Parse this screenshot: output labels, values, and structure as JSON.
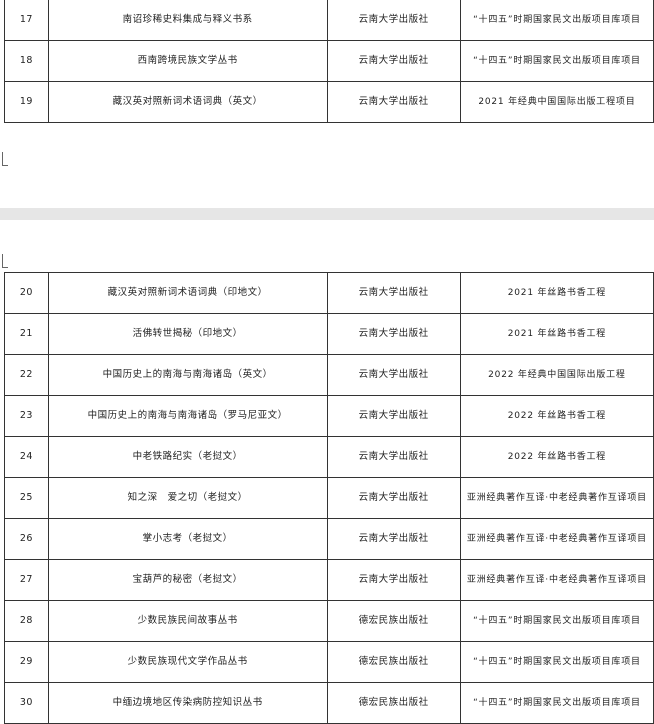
{
  "table_top": {
    "rows": [
      {
        "no": "17",
        "title": "南诏珍稀史料集成与释义书系",
        "publisher": "云南大学出版社",
        "project": "“十四五”时期国家民文出版项目库项目"
      },
      {
        "no": "18",
        "title": "西南跨境民族文学丛书",
        "publisher": "云南大学出版社",
        "project": "“十四五”时期国家民文出版项目库项目"
      },
      {
        "no": "19",
        "title": "藏汉英对照新词术语词典（英文）",
        "publisher": "云南大学出版社",
        "project": "2021 年经典中国国际出版工程项目"
      }
    ]
  },
  "table_bottom": {
    "rows": [
      {
        "no": "20",
        "title": "藏汉英对照新词术语词典（印地文）",
        "publisher": "云南大学出版社",
        "project": "2021 年丝路书香工程"
      },
      {
        "no": "21",
        "title": "活佛转世揭秘（印地文）",
        "publisher": "云南大学出版社",
        "project": "2021 年丝路书香工程"
      },
      {
        "no": "22",
        "title": "中国历史上的南海与南海诸岛（英文）",
        "publisher": "云南大学出版社",
        "project": "2022 年经典中国国际出版工程"
      },
      {
        "no": "23",
        "title": "中国历史上的南海与南海诸岛（罗马尼亚文）",
        "publisher": "云南大学出版社",
        "project": "2022 年丝路书香工程"
      },
      {
        "no": "24",
        "title": "中老铁路纪实（老挝文）",
        "publisher": "云南大学出版社",
        "project": "2022 年丝路书香工程"
      },
      {
        "no": "25",
        "title": "知之深　爱之切（老挝文）",
        "publisher": "云南大学出版社",
        "project": "亚洲经典著作互译·中老经典著作互译项目"
      },
      {
        "no": "26",
        "title": "掌小志考（老挝文）",
        "publisher": "云南大学出版社",
        "project": "亚洲经典著作互译·中老经典著作互译项目"
      },
      {
        "no": "27",
        "title": "宝葫芦的秘密（老挝文）",
        "publisher": "云南大学出版社",
        "project": "亚洲经典著作互译·中老经典著作互译项目"
      },
      {
        "no": "28",
        "title": "少数民族民间故事丛书",
        "publisher": "德宏民族出版社",
        "project": "“十四五”时期国家民文出版项目库项目"
      },
      {
        "no": "29",
        "title": "少数民族现代文学作品丛书",
        "publisher": "德宏民族出版社",
        "project": "“十四五”时期国家民文出版项目库项目"
      },
      {
        "no": "30",
        "title": "中缅边境地区传染病防控知识丛书",
        "publisher": "德宏民族出版社",
        "project": "“十四五”时期国家民文出版项目库项目"
      }
    ]
  }
}
